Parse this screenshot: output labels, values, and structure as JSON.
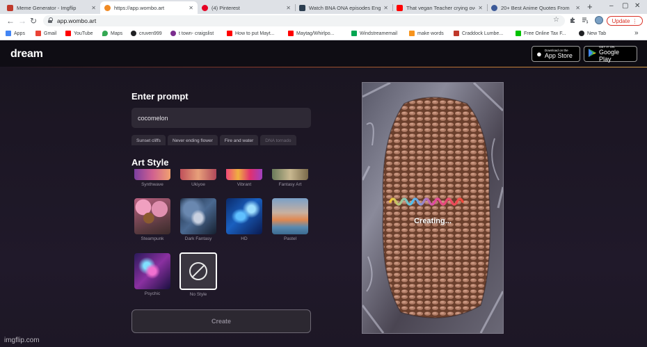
{
  "browser": {
    "tabs": [
      {
        "title": "Meme Generator - Imgflip",
        "color": "#c0392b",
        "active": false
      },
      {
        "title": "https://app.wombo.art",
        "color": "#f08a24",
        "active": true
      },
      {
        "title": "(4) Pinterest",
        "color": "#e60023",
        "active": false
      },
      {
        "title": "Watch BNA ONA episodes Eng",
        "color": "#2c3e50",
        "active": false
      },
      {
        "title": "That vegan Teacher crying ove",
        "color": "#ff0000",
        "active": false
      },
      {
        "title": "20+ Best Anime Quotes From",
        "color": "#3b5998",
        "active": false
      }
    ],
    "new_tab": "+",
    "url": "app.wombo.art",
    "update_label": "Update",
    "bookmarks": [
      {
        "label": "Apps",
        "color": "#4285f4"
      },
      {
        "label": "Gmail",
        "color": "#ea4335"
      },
      {
        "label": "YouTube",
        "color": "#ff0000"
      },
      {
        "label": "Maps",
        "color": "#34a853"
      },
      {
        "label": "cruven999",
        "color": "#202124"
      },
      {
        "label": "t town- craigslist",
        "color": "#7b2d8e"
      },
      {
        "label": "How to put Mayt...",
        "color": "#ff0000"
      },
      {
        "label": "Maytag/Whirlpo...",
        "color": "#ff0000"
      },
      {
        "label": "Windstreamemail",
        "color": "#00a651"
      },
      {
        "label": "make words",
        "color": "#f7941d"
      },
      {
        "label": "Craddock Lumbe...",
        "color": "#c0392b"
      },
      {
        "label": "Free Online Tax F...",
        "color": "#00c200"
      },
      {
        "label": "New Tab",
        "color": "#202124"
      }
    ],
    "bookmarks_more": "»"
  },
  "header": {
    "logo": "dream",
    "app_store": {
      "small": "Download on the",
      "big": "App Store"
    },
    "google_play": {
      "small": "GET IT ON",
      "big": "Google Play"
    }
  },
  "prompt": {
    "heading": "Enter prompt",
    "value": "cocomelon",
    "suggestions": [
      "Sunset cliffs",
      "Never ending flower",
      "Fire and water",
      "DNA tornado"
    ]
  },
  "art_style": {
    "heading": "Art Style",
    "styles": [
      {
        "label": "Synthwave"
      },
      {
        "label": "Ukiyoe"
      },
      {
        "label": "Vibrant"
      },
      {
        "label": "Fantasy Art"
      },
      {
        "label": "Steampunk"
      },
      {
        "label": "Dark Fantasy"
      },
      {
        "label": "HD"
      },
      {
        "label": "Pastel"
      },
      {
        "label": "Psychic"
      },
      {
        "label": "No Style",
        "selected": true
      }
    ]
  },
  "create_button": "Create",
  "preview": {
    "status": "Creating..."
  },
  "watermark": "imgflip.com"
}
